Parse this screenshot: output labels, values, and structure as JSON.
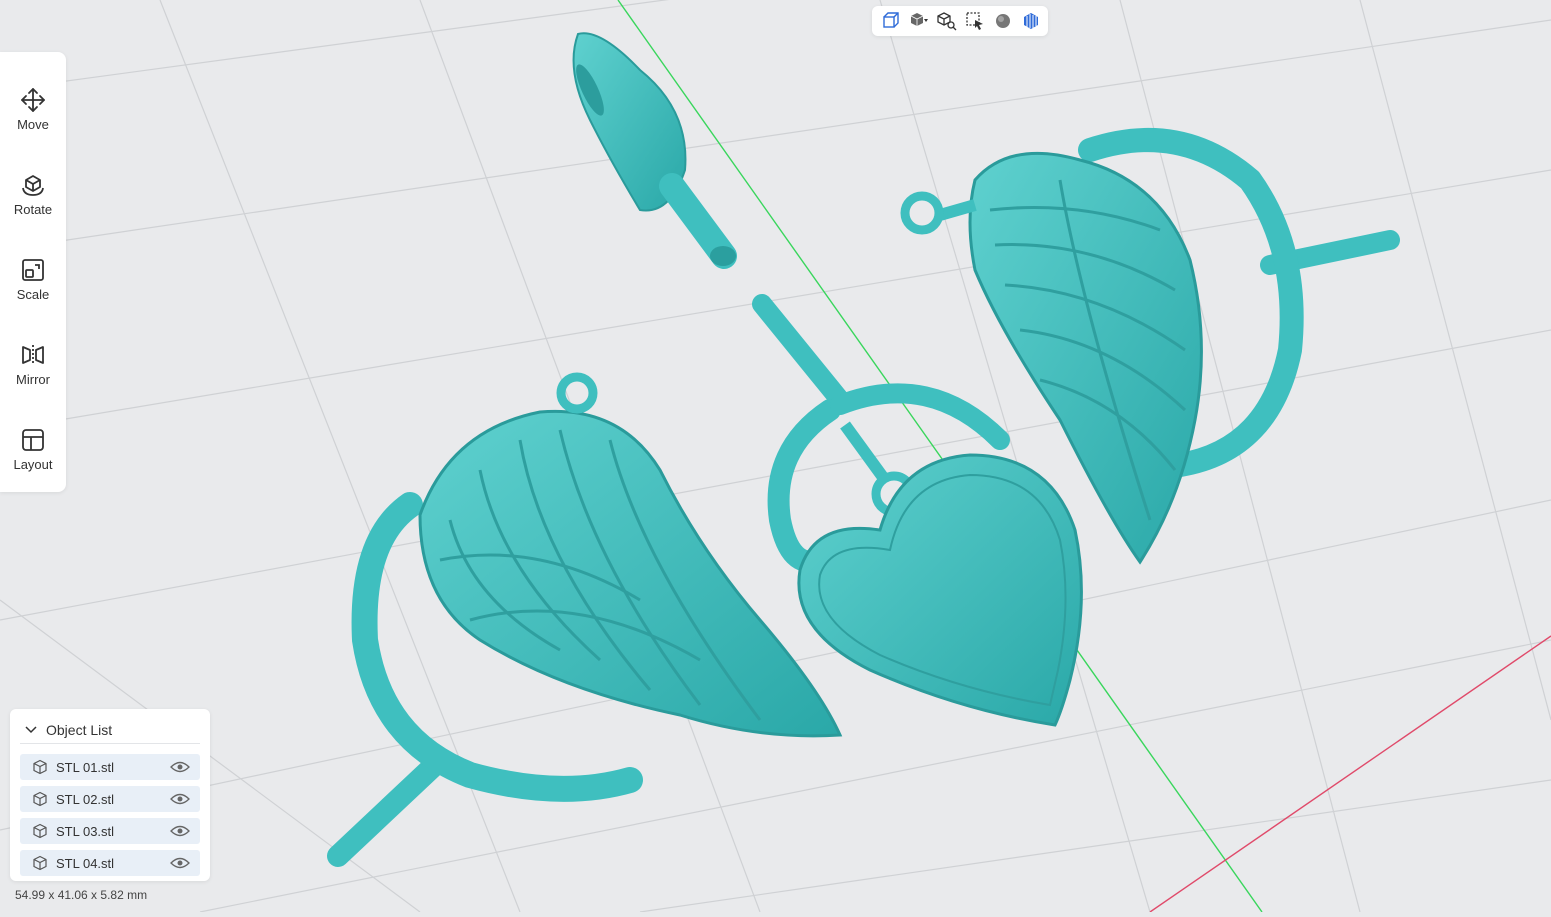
{
  "toolbar": {
    "items": [
      {
        "label": "Move",
        "icon": "move-icon"
      },
      {
        "label": "Rotate",
        "icon": "rotate-icon"
      },
      {
        "label": "Scale",
        "icon": "scale-icon"
      },
      {
        "label": "Mirror",
        "icon": "mirror-icon"
      },
      {
        "label": "Layout",
        "icon": "layout-icon"
      }
    ]
  },
  "viewbar": {
    "buttons": [
      "view-cube-icon",
      "solid-view-dropdown-icon",
      "view-search-icon",
      "select-icon",
      "material-sphere-icon",
      "shading-icon"
    ]
  },
  "object_list": {
    "title": "Object List",
    "items": [
      {
        "name": "STL 01.stl"
      },
      {
        "name": "STL 02.stl"
      },
      {
        "name": "STL 03.stl"
      },
      {
        "name": "STL 04.stl"
      }
    ]
  },
  "dimensions": "54.99 x 41.06 x 5.82 mm",
  "colors": {
    "model": "#3fbfbf",
    "background": "#e9eaec",
    "grid": "#cfd1d4",
    "axis_green": "#39d65c",
    "axis_red": "#e04a6a"
  }
}
